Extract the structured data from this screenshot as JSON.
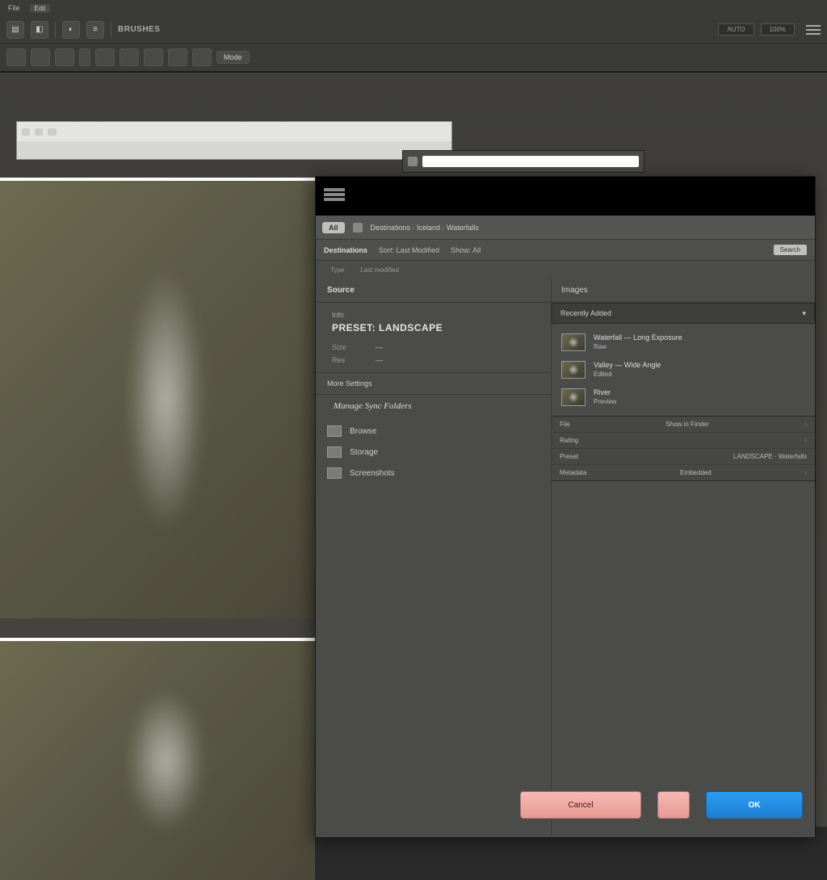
{
  "menubar": {
    "items": [
      "File",
      "Edit"
    ]
  },
  "toolbar1": {
    "label": "BRUSHES",
    "right1": "AUTO",
    "right2": "100%"
  },
  "toolbar2": {
    "btn_label": "Mode"
  },
  "dialog": {
    "row1": {
      "chip": "All",
      "crumb": "Destinations · Iceland · Waterfalls"
    },
    "row2": {
      "bold": "Destinations",
      "sub1": "Sort: Last Modified",
      "sub2": "Show: All",
      "right": "Search"
    },
    "row3": {
      "c1": "Type",
      "c2": "Last modified"
    },
    "left": {
      "source_head": "Source",
      "info_label": "Info",
      "preset_value": "PRESET: LANDSCAPE",
      "size_k": "Size",
      "size_v": "—",
      "res_k": "Res",
      "res_v": "—",
      "more_head": "More Settings",
      "more_sub": "Manage Sync Folders",
      "items": [
        "Browse",
        "Storage",
        "Screenshots"
      ]
    },
    "right": {
      "head": "Images",
      "dropdown": "Recently Added",
      "thumbs": [
        {
          "t1": "Waterfall — Long Exposure",
          "t2": "Raw"
        },
        {
          "t1": "Valley — Wide Angle",
          "t2": "Edited"
        },
        {
          "t1": "River",
          "t2": "Preview"
        }
      ],
      "panel2": [
        {
          "k": "File",
          "v": "Show in Finder"
        },
        {
          "k": "Rating",
          "v": ""
        },
        {
          "k": "Preset",
          "v": "LANDSCAPE · Waterfalls"
        },
        {
          "k": "Metadata",
          "v": "Embedded"
        }
      ]
    }
  },
  "buttons": {
    "cancel": "Cancel",
    "ok": "OK"
  }
}
